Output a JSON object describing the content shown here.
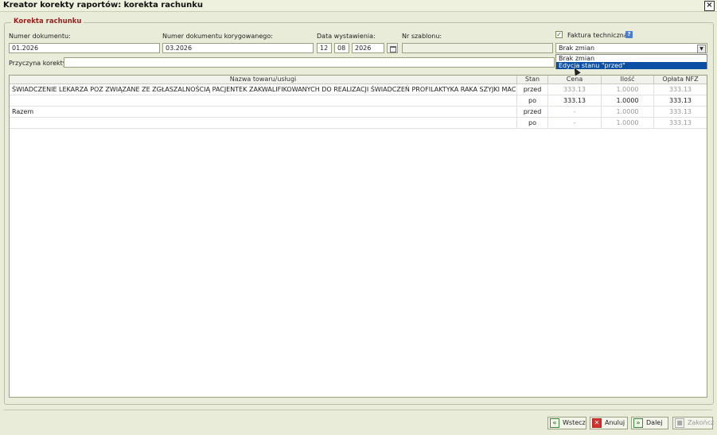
{
  "window": {
    "title": "Kreator korekty raportów: korekta rachunku",
    "close_label": "×"
  },
  "group": {
    "legend": "Korekta rachunku"
  },
  "form": {
    "doc_number_label": "Numer dokumentu:",
    "doc_number_value": "01.2026",
    "corrected_doc_label": "Numer dokumentu korygowanego:",
    "corrected_doc_value": "03.2026",
    "date_label": "Data wystawienia:",
    "date_day": "12",
    "date_month": "08",
    "date_year": "2026",
    "template_label": "Nr szablonu:",
    "template_value": "",
    "technical_invoice_label": "Faktura techniczna",
    "technical_invoice_checked": true,
    "info_icon_label": "?",
    "mode_selected": "Brak zmian",
    "mode_options": [
      "Brak zmian",
      "Edycja stanu \"przed\""
    ],
    "reason_label": "Przyczyna korekty:",
    "reason_value": ""
  },
  "table": {
    "columns": [
      "Nazwa towaru/usługi",
      "Stan",
      "Cena",
      "Ilość",
      "Opłata NFZ"
    ],
    "rows": [
      {
        "name": "ŚWIADCZENIE LEKARZA POZ ZWIĄZANE ZE ZGŁASZALNOŚCIĄ PACJENTEK ZAKWALIFIKOWANYCH DO REALIZACJI ŚWIADCZEŃ PROFILAKTYKA RAKA SZYJKI MACICY",
        "stan": "przed",
        "cena": "333.13",
        "ilosc": "1.0000",
        "oplata": "333.13"
      },
      {
        "name": "",
        "stan": "po",
        "cena": "333.13",
        "ilosc": "1.0000",
        "oplata": "333.13"
      },
      {
        "name": "Razem",
        "stan": "przed",
        "cena": "-",
        "ilosc": "1.0000",
        "oplata": "333.13"
      },
      {
        "name": "",
        "stan": "po",
        "cena": "-",
        "ilosc": "1.0000",
        "oplata": "333.13"
      }
    ]
  },
  "buttons": {
    "back": "Wstecz",
    "cancel": "Anuluj",
    "next": "Dalej",
    "finish": "Zakończ"
  }
}
